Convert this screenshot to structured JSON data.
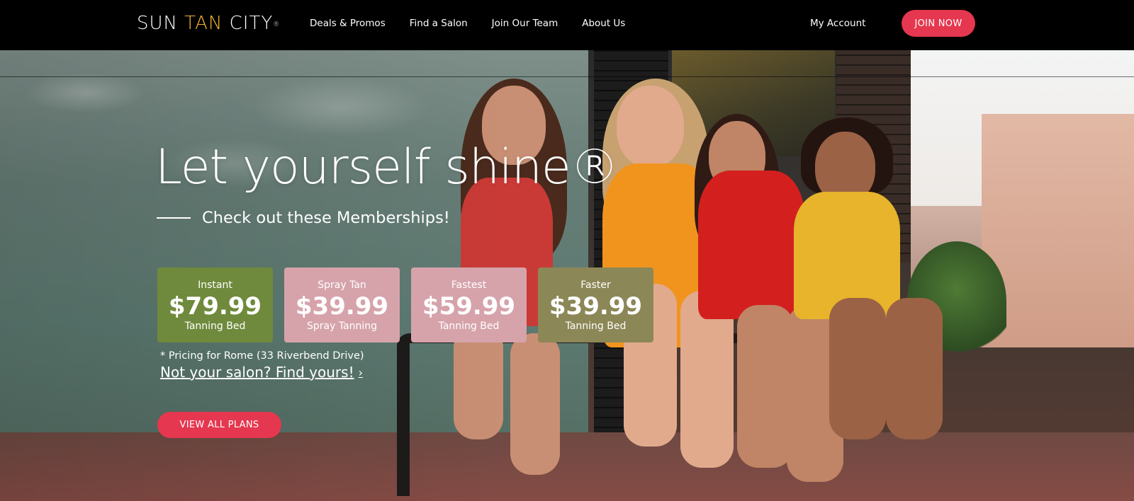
{
  "header": {
    "logo": {
      "part1": "SUN ",
      "part2": "TAN",
      "part3": " CITY",
      "mark": "®"
    },
    "nav": [
      {
        "label": "Deals & Promos"
      },
      {
        "label": "Find a Salon"
      },
      {
        "label": "Join Our Team"
      },
      {
        "label": "About Us"
      }
    ],
    "my_account": "My Account",
    "join_now": "JOIN NOW"
  },
  "hero": {
    "headline": "Let yourself shine®",
    "subheading": "Check out these Memberships!",
    "cards": [
      {
        "name": "Instant",
        "price": "$79.99",
        "type": "Tanning Bed",
        "color": "#6f8a3c"
      },
      {
        "name": "Spray Tan",
        "price": "$39.99",
        "type": "Spray Tanning",
        "color": "#d6a3ab"
      },
      {
        "name": "Fastest",
        "price": "$59.99",
        "type": "Tanning Bed",
        "color": "#d6a3ab"
      },
      {
        "name": "Faster",
        "price": "$39.99",
        "type": "Tanning Bed",
        "color": "#8c8757"
      }
    ],
    "pricing_note": "* Pricing for Rome (33 Riverbend Drive)",
    "find_link": "Not your salon? Find yours!",
    "find_chevron": "›",
    "view_all": "VIEW ALL PLANS"
  },
  "colors": {
    "accent": "#e5374f",
    "logo_highlight": "#f2b632",
    "header_bg": "#000000"
  }
}
